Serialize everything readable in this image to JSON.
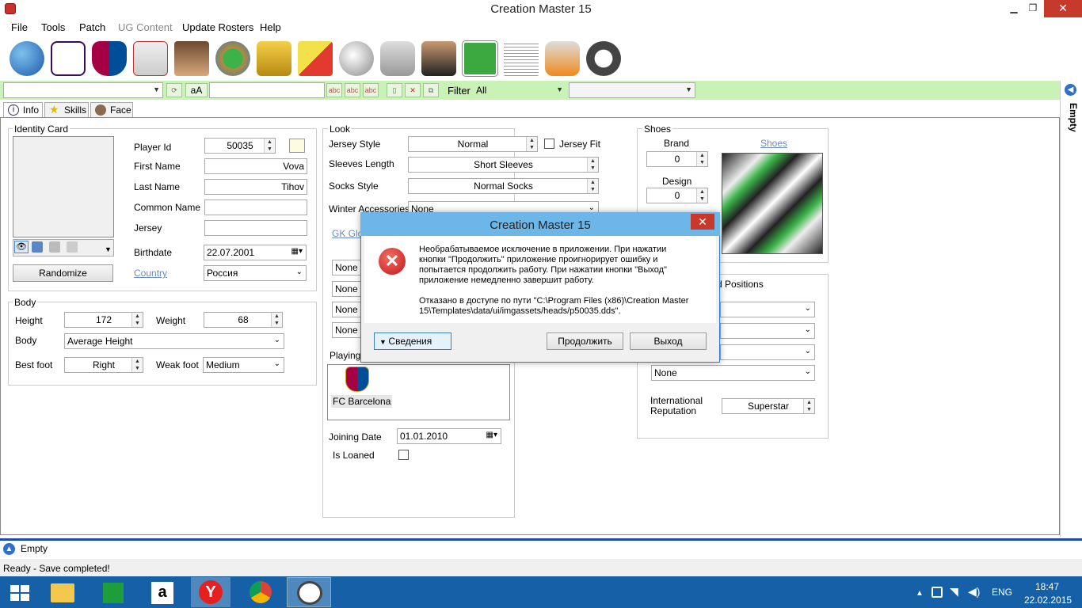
{
  "window": {
    "title": "Creation Master 15",
    "minimize": "▁",
    "restore": "❐",
    "close": "✕"
  },
  "menu": [
    "File",
    "Tools",
    "Patch",
    "UG Content",
    "Update Rosters",
    "Help"
  ],
  "toolbar_icons": [
    "globe-icon",
    "premier-league-icon",
    "fcb-crest-icon",
    "jersey-icon",
    "player-face-icon",
    "stadium-icon",
    "world-cup-trophy-icon",
    "referee-cards-icon",
    "ball-icon",
    "boot-icon",
    "manager-icon",
    "pitch-icon",
    "newspaper-icon",
    "goalkeeper-glove-icon",
    "headphones-icon"
  ],
  "searchbar": {
    "aa_label": "aA",
    "filter_label": "Filter",
    "filter_value": "All",
    "abc": "abc"
  },
  "tabs": [
    "Info",
    "Skills",
    "Face"
  ],
  "identity": {
    "group_title": "Identity Card",
    "player_id_label": "Player Id",
    "player_id": "50035",
    "first_name_label": "First Name",
    "first_name": "Vova",
    "last_name_label": "Last Name",
    "last_name": "Tihov",
    "common_name_label": "Common Name",
    "common_name": "",
    "jersey_label": "Jersey",
    "jersey": "",
    "birthdate_label": "Birthdate",
    "birthdate": "22.07.2001",
    "country_label": "Country",
    "country": "Россия",
    "randomize": "Randomize"
  },
  "body": {
    "group_title": "Body",
    "height_label": "Height",
    "height": "172",
    "weight_label": "Weight",
    "weight": "68",
    "body_label": "Body",
    "body": "Average Height",
    "bestfoot_label": "Best foot",
    "bestfoot": "Right",
    "weakfoot_label": "Weak foot",
    "weakfoot": "Medium"
  },
  "look": {
    "group_title": "Look",
    "jersey_style_label": "Jersey Style",
    "jersey_style": "Normal",
    "jersey_fit_label": "Jersey Fit",
    "sleeves_label": "Sleeves Length",
    "sleeves": "Short Sleeves",
    "socks_label": "Socks Style",
    "socks": "Normal Socks",
    "winter_label": "Winter Accessories",
    "winter": "None",
    "gk_label": "GK Glov",
    "nones": [
      "None",
      "None",
      "None",
      "None"
    ]
  },
  "playing": {
    "group_title": "Playing f",
    "club": "FC Barcelona",
    "joining_label": "Joining Date",
    "joining": "01.01.2010",
    "loaned_label": "Is Loaned"
  },
  "shoes": {
    "group_title": "Shoes",
    "brand_label": "Brand",
    "brand": "0",
    "design_label": "Design",
    "design": "0",
    "shoes_link": "Shoes"
  },
  "positions": {
    "group_title": "d Positions",
    "none": "None",
    "intl_rep_label": "International Reputation",
    "intl_rep": "Superstar"
  },
  "sidebar": {
    "label": "Empty"
  },
  "bottom": {
    "label": "Empty"
  },
  "status": "Ready - Save completed!",
  "dialog": {
    "title": "Creation Master 15",
    "message1": "Необрабатываемое исключение в приложении. При нажатии кнопки \"Продолжить\" приложение проигнорирует ошибку и попытается продолжить работу. При нажатии кнопки \"Выход\" приложение немедленно завершит работу.",
    "message2": "Отказано в доступе по пути \"C:\\Program Files (x86)\\Creation Master 15\\Templates\\data/ui/imgassets/heads/p50035.dds\".",
    "details": "Сведения",
    "continue": "Продолжить",
    "exit": "Выход"
  },
  "taskbar": {
    "lang": "ENG",
    "time": "18:47",
    "date": "22.02.2015"
  }
}
